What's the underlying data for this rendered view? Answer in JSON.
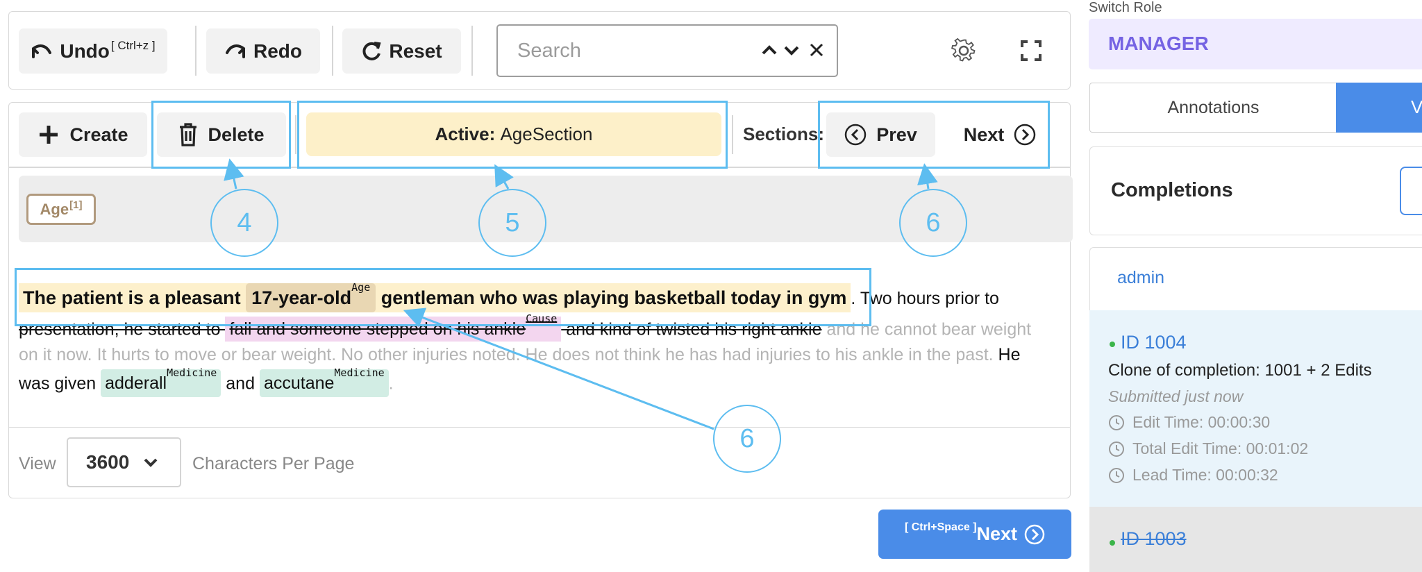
{
  "toolbar": {
    "undo_label": "Undo",
    "undo_shortcut": "[ Ctrl+z ]",
    "redo_label": "Redo",
    "reset_label": "Reset",
    "search_placeholder": "Search"
  },
  "section_bar": {
    "create_label": "Create",
    "delete_label": "Delete",
    "active_prefix": "Active:",
    "active_value": "AgeSection",
    "sections_label": "Sections:",
    "prev_label": "Prev",
    "next_label": "Next"
  },
  "labels": {
    "age_chip": "Age",
    "age_chip_index": "[1]"
  },
  "document": {
    "line1": {
      "hl_start": "The patient is a pleasant ",
      "age_entity": "17-year-old",
      "age_tag": "Age",
      "hl_end": " gentleman who was playing basketball today in gym",
      "plain": ". Two hours prior to"
    },
    "line2": {
      "strike1": "presentation, he started to ",
      "cause_entity": "fall and someone stepped on his ankle",
      "cause_tag": "Cause",
      "strike2": " and kind of twisted his right ankle",
      "gray": " and he cannot bear weight"
    },
    "line3": {
      "gray": "on it now. It hurts to move or bear weight. No other injuries noted. He does not think he has had injuries to his ankle in the past.",
      "plain": " He"
    },
    "line4": {
      "pre": "was given ",
      "med1": "adderall",
      "med1_tag": "Medicine",
      "mid": " and ",
      "med2": "accutane",
      "med2_tag": "Medicine",
      "post": "."
    }
  },
  "pagination": {
    "view_label": "View",
    "per_page_value": "3600",
    "per_page_label": "Characters Per Page"
  },
  "submit": {
    "shortcut": "[ Ctrl+Space ]",
    "label": "Next"
  },
  "sidebar": {
    "switch_role_label": "Switch Role",
    "role": "MANAGER",
    "tab_annotations": "Annotations",
    "tab_v": "V",
    "completions_title": "Completions",
    "admin_label": "admin",
    "card1": {
      "id": "ID 1004",
      "desc": "Clone of completion: 1001 + 2 Edits",
      "status": "Submitted just now",
      "edit_time": "Edit Time: 00:00:30",
      "total_edit_time": "Total Edit Time: 00:01:02",
      "lead_time": "Lead Time: 00:00:32"
    },
    "card2": {
      "id": "ID 1003"
    }
  },
  "callouts": {
    "c4": "4",
    "c5": "5",
    "c6a": "6",
    "c6b": "6"
  },
  "colors": {
    "accent": "#4a8ce8",
    "callout": "#5dbdf0",
    "active_bg": "#fdf0c9",
    "role_text": "#7563e3"
  }
}
